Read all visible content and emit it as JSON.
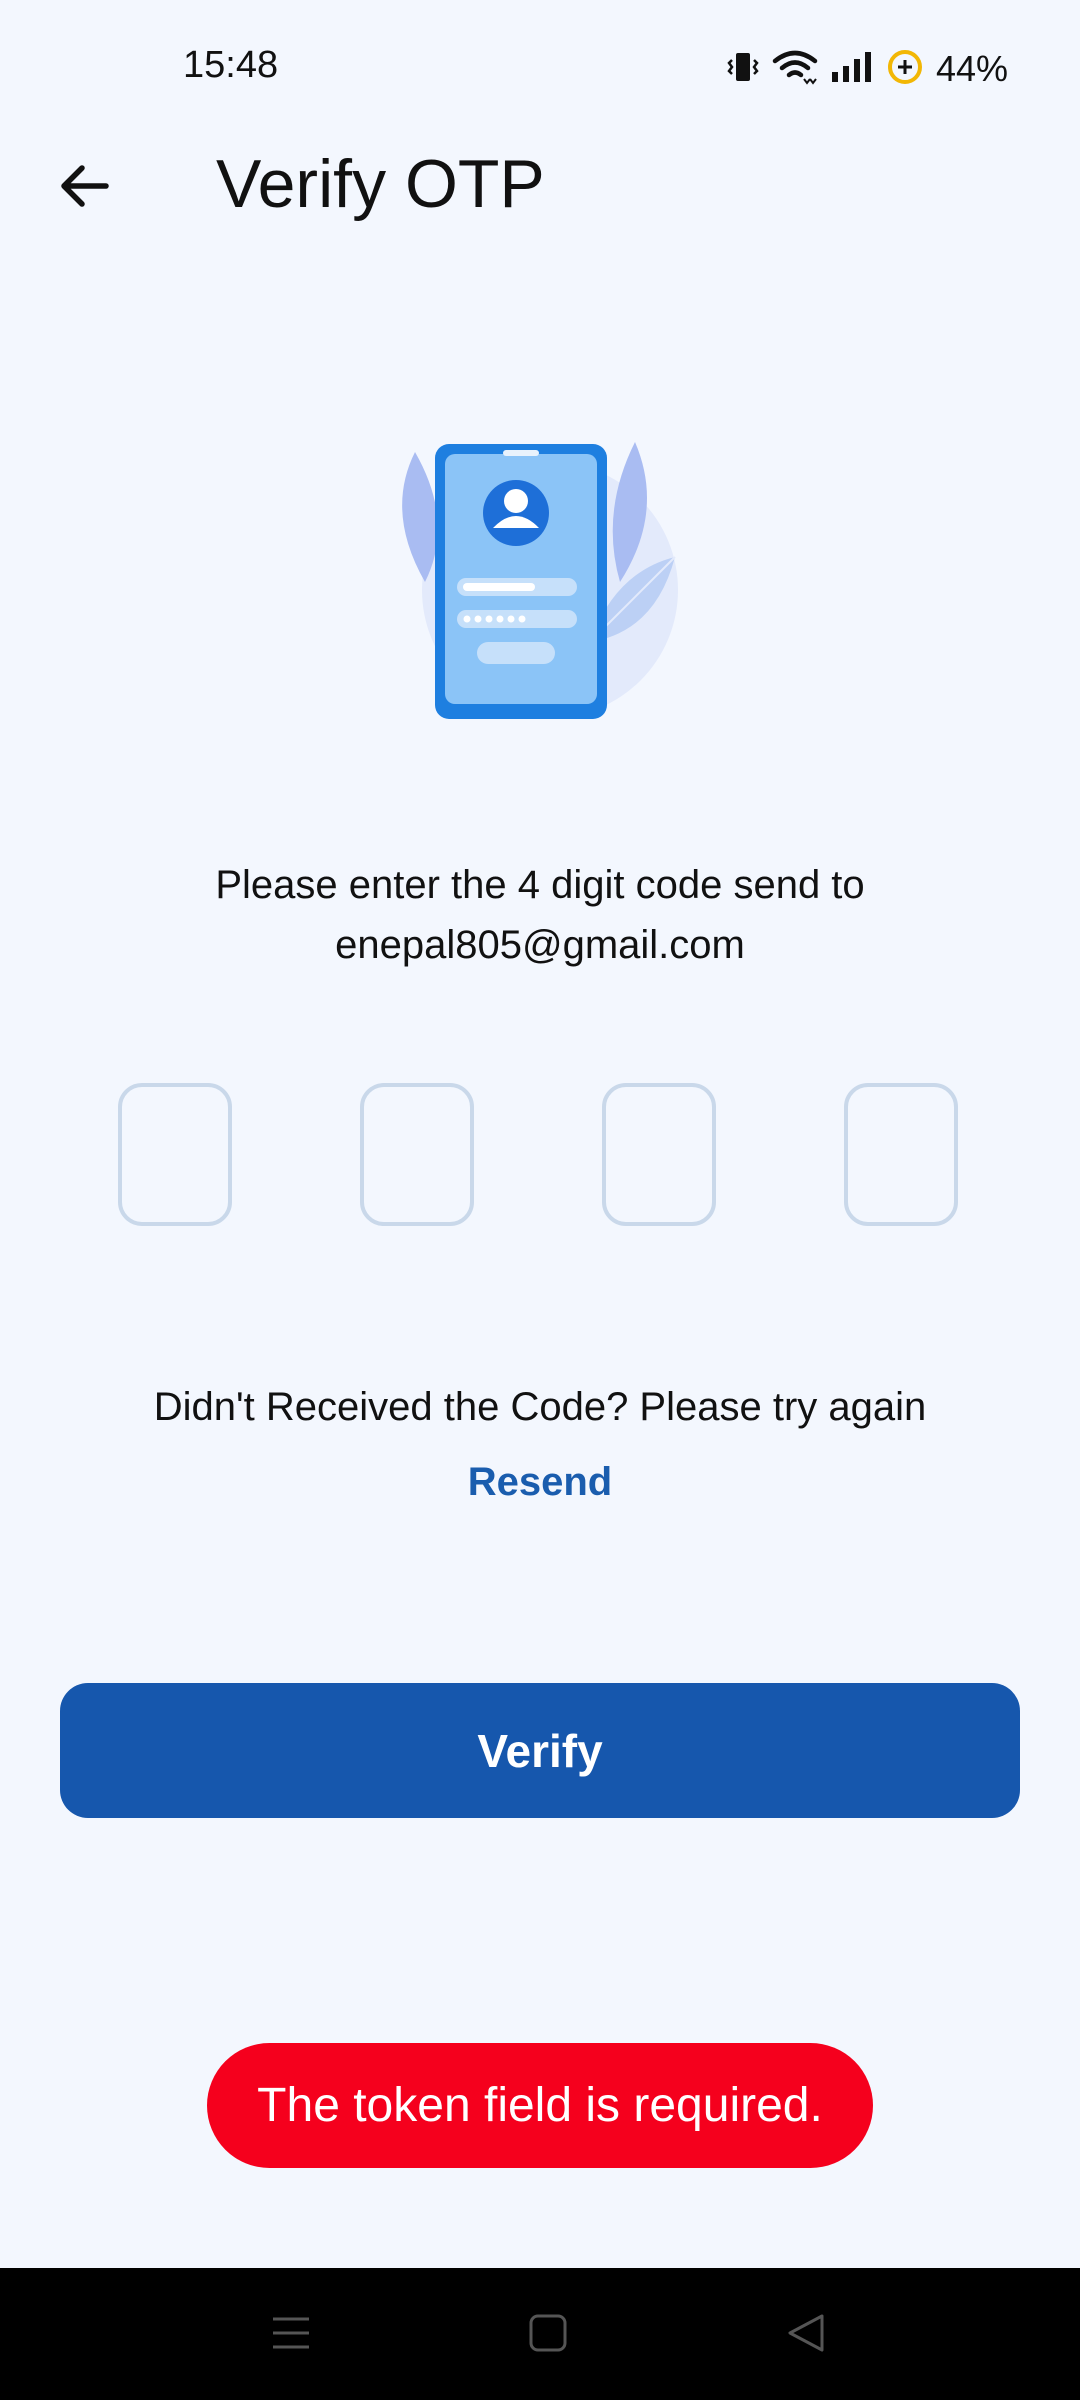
{
  "status_bar": {
    "time": "15:48",
    "battery": "44%",
    "icons": [
      "vibrate-icon",
      "wifi-icon",
      "signal-icon",
      "battery-saver-icon"
    ]
  },
  "app_bar": {
    "title": "Verify OTP",
    "back_icon": "arrow-left-icon"
  },
  "illustration": {
    "icon": "phone-login-illustration"
  },
  "instruction": {
    "line1": "Please enter the 4 digit code send to",
    "email": "enepal805@gmail.com"
  },
  "otp": {
    "digits": [
      "",
      "",
      "",
      ""
    ]
  },
  "resend": {
    "prompt": "Didn't Received the Code? Please try again",
    "link_label": "Resend"
  },
  "verify_button": {
    "label": "Verify"
  },
  "toast": {
    "message": "The token field is required."
  },
  "nav_bar": {
    "icons": [
      "menu-icon",
      "home-icon",
      "back-triangle-icon"
    ]
  },
  "colors": {
    "background": "#F3F7FE",
    "primary": "#1657AD",
    "link": "#1A5DAE",
    "error": "#F5001D",
    "otp_border": "#C9D8EA"
  }
}
